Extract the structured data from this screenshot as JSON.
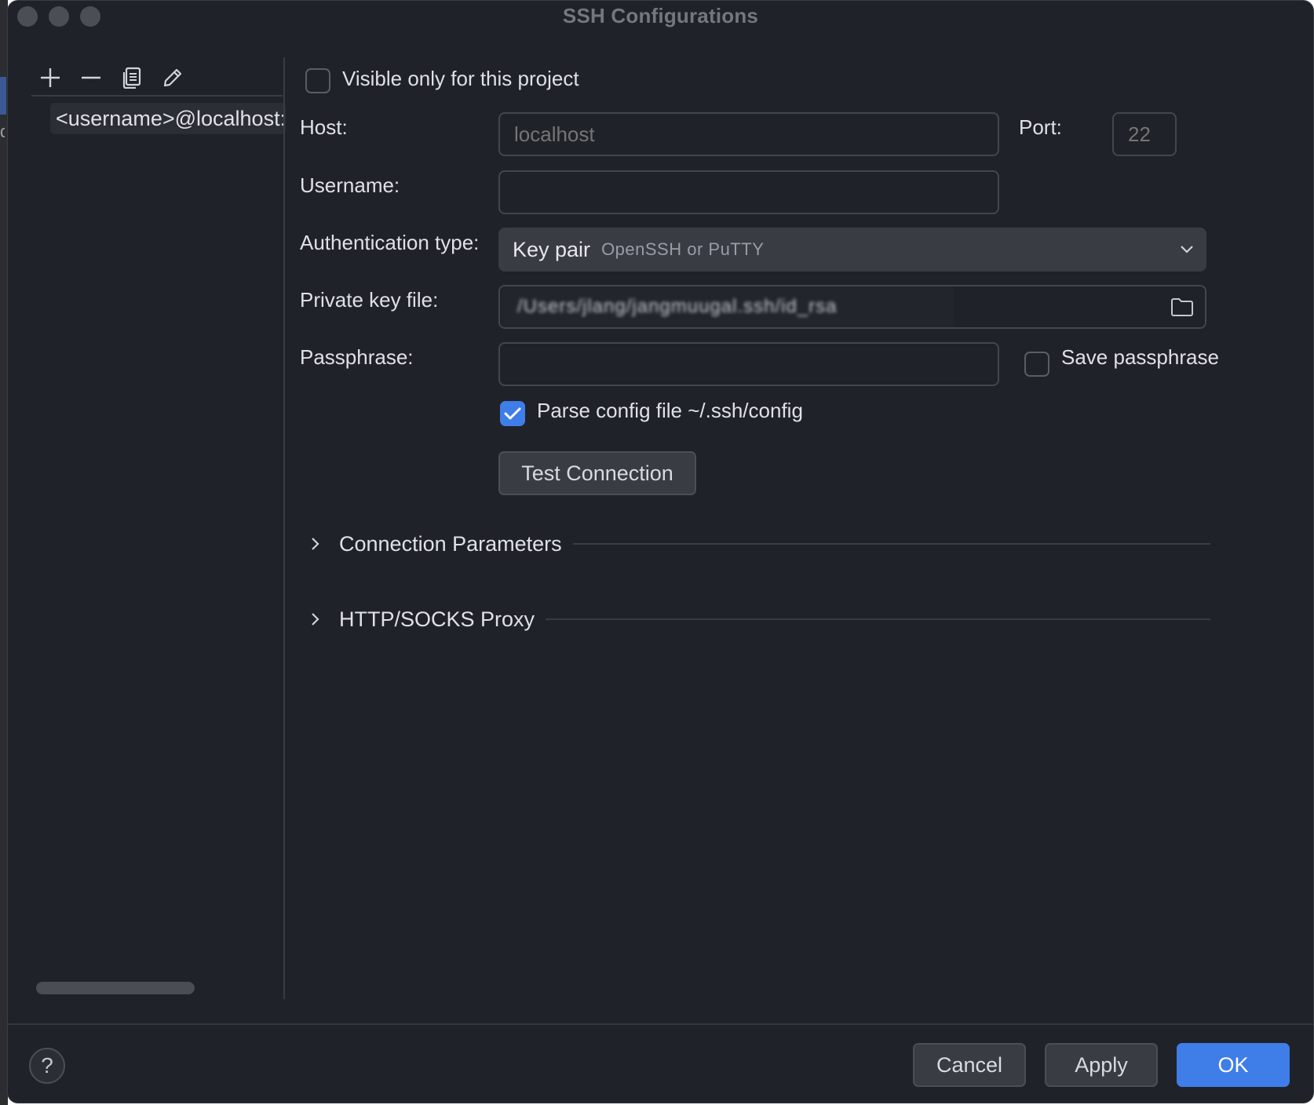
{
  "window": {
    "title": "SSH Configurations"
  },
  "sidebar": {
    "toolbar": {
      "add": "add-icon",
      "remove": "remove-icon",
      "copy": "copy-icon",
      "edit": "edit-icon"
    },
    "items": [
      {
        "label": "<username>@localhost:"
      }
    ]
  },
  "form": {
    "visible_only_label": "Visible only for this project",
    "visible_only_checked": false,
    "host_label": "Host:",
    "host_placeholder": "localhost",
    "port_label": "Port:",
    "port_placeholder": "22",
    "username_label": "Username:",
    "username_value": "",
    "auth_label": "Authentication type:",
    "auth_value": "Key pair",
    "auth_hint": "OpenSSH or PuTTY",
    "private_key_label": "Private key file:",
    "private_key_value": "/Users/jlang/jangmuugal.ssh/id_rsa",
    "passphrase_label": "Passphrase:",
    "passphrase_value": "",
    "save_passphrase_label": "Save passphrase",
    "save_passphrase_checked": false,
    "parse_config_label": "Parse config file ~/.ssh/config",
    "parse_config_checked": true,
    "test_connection_label": "Test Connection"
  },
  "sections": {
    "connection_parameters": "Connection Parameters",
    "proxy": "HTTP/SOCKS Proxy"
  },
  "footer": {
    "help": "?",
    "cancel": "Cancel",
    "apply": "Apply",
    "ok": "OK"
  },
  "colors": {
    "background": "#1f2228",
    "accent": "#3f7de8",
    "field_border": "#43464d"
  }
}
